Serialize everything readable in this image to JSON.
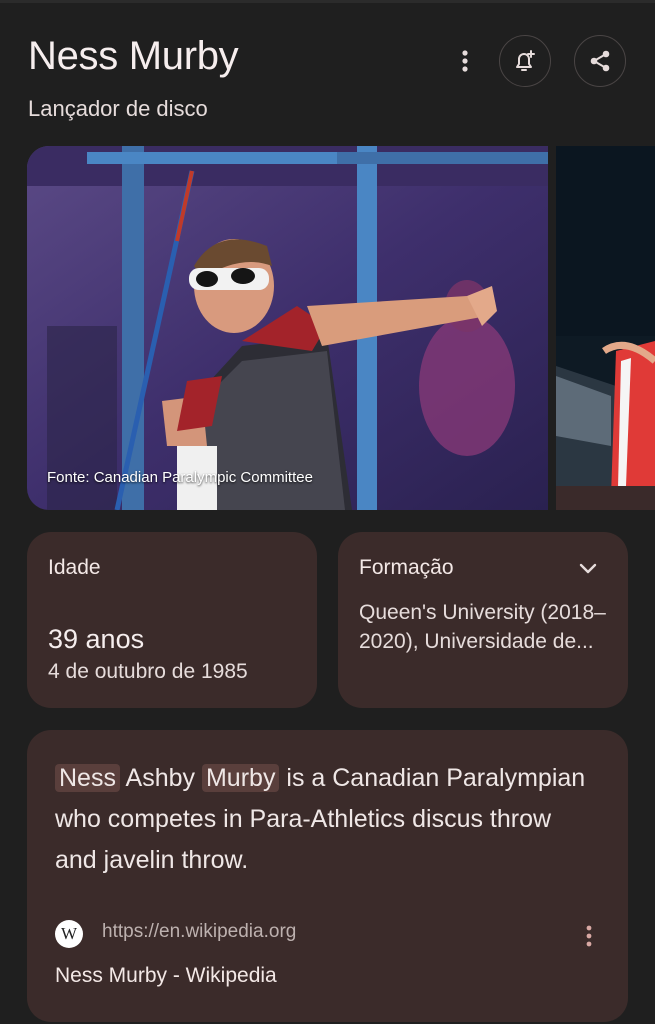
{
  "header": {
    "title": "Ness Murby",
    "subtitle": "Lançador de disco"
  },
  "actions": {
    "more_icon": "more-vert-icon",
    "bell_icon": "notification-add-icon",
    "share_icon": "share-icon"
  },
  "images": {
    "caption": "Fonte: Canadian Paralympic Committee"
  },
  "age_card": {
    "label": "Idade",
    "value": "39 anos",
    "date": "4 de outubro de 1985"
  },
  "education_card": {
    "label": "Formação",
    "text": "Queen's University (2018–2020), Universidade de..."
  },
  "description": {
    "highlight1": "Ness",
    "middle": "Ashby",
    "highlight2": "Murby",
    "rest": "is a Canadian Paralympian who competes in Para-Athletics discus throw and javelin throw.",
    "logo": "W",
    "url": "https://en.wikipedia.org",
    "source_title": "Ness Murby - Wikipedia"
  },
  "colors": {
    "background": "#1f1f1f",
    "card": "#3b2b2a",
    "highlight": "#5a3f3c"
  }
}
